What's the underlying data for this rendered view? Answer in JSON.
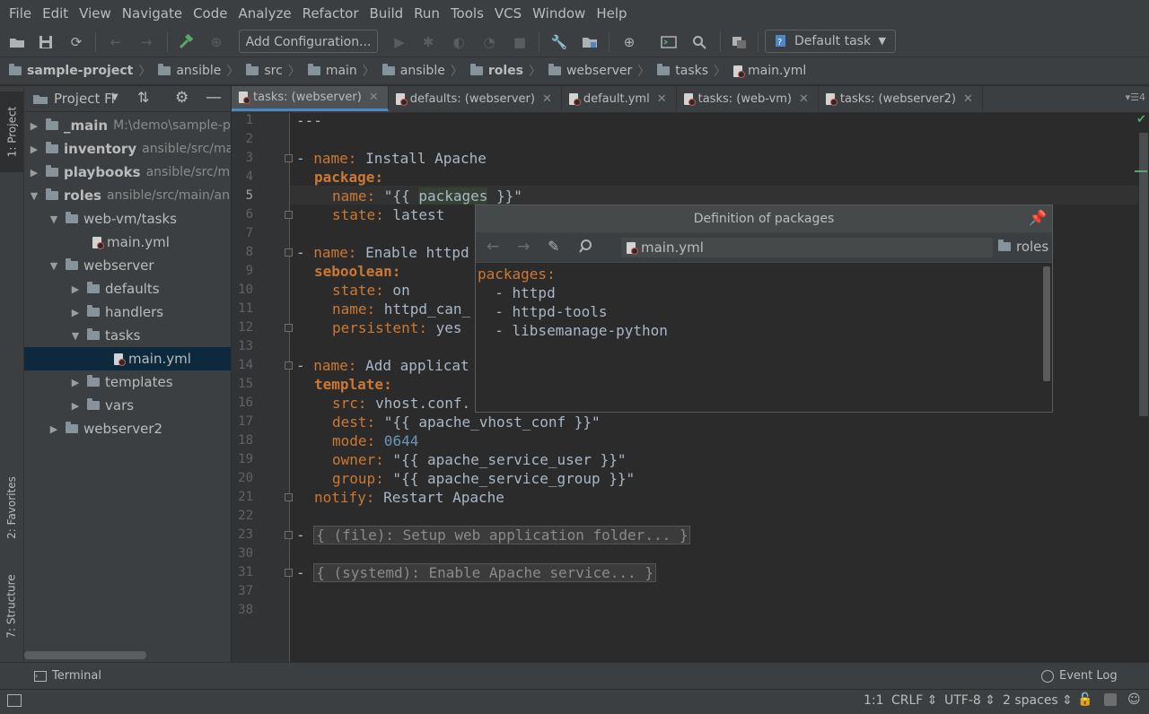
{
  "menu": [
    "File",
    "Edit",
    "View",
    "Navigate",
    "Code",
    "Analyze",
    "Refactor",
    "Build",
    "Run",
    "Tools",
    "VCS",
    "Window",
    "Help"
  ],
  "toolbar": {
    "add_config_label": "Add Configuration...",
    "task_label": "Default task"
  },
  "breadcrumb": [
    "sample-project",
    "ansible",
    "src",
    "main",
    "ansible",
    "roles",
    "webserver",
    "tasks",
    "main.yml"
  ],
  "left_strip": {
    "project": "1: Project",
    "favorites": "2: Favorites",
    "structure": "7: Structure"
  },
  "project_panel": {
    "title": "Project Fi",
    "tree": [
      {
        "label": "_main",
        "sub": "M:\\demo\\sample-p",
        "bold": true
      },
      {
        "label": "inventory",
        "sub": "ansible/src/ma",
        "bold": true
      },
      {
        "label": "playbooks",
        "sub": "ansible/src/m",
        "bold": true
      },
      {
        "label": "roles",
        "sub": "ansible/src/main/an",
        "bold": true
      },
      {
        "label": "web-vm/tasks"
      },
      {
        "label": "main.yml"
      },
      {
        "label": "webserver"
      },
      {
        "label": "defaults"
      },
      {
        "label": "handlers"
      },
      {
        "label": "tasks"
      },
      {
        "label": "main.yml"
      },
      {
        "label": "templates"
      },
      {
        "label": "vars"
      },
      {
        "label": "webserver2"
      }
    ]
  },
  "tabs": [
    "tasks: (webserver)",
    "defaults: (webserver)",
    "default.yml",
    "tasks: (web-vm)",
    "tasks: (webserver2)"
  ],
  "tabs_extra": "4",
  "editor": {
    "line_numbers": [
      "1",
      "2",
      "3",
      "4",
      "5",
      "6",
      "7",
      "8",
      "9",
      "10",
      "11",
      "12",
      "13",
      "14",
      "15",
      "16",
      "17",
      "18",
      "19",
      "20",
      "21",
      "22",
      "23",
      "30",
      "31",
      "37",
      "38"
    ],
    "lines": {
      "l1": "---",
      "l3_dash": "- ",
      "l3_key": "name:",
      "l3_val": " Install Apache",
      "l4_key": "package:",
      "l5_key": "name:",
      "l5_q1": " \"{{ ",
      "l5_var": "packages",
      "l5_q2": " }}\"",
      "l6_key": "state:",
      "l6_val": " latest",
      "l8_dash": "- ",
      "l8_key": "name:",
      "l8_val": " Enable httpd",
      "l9_key": "seboolean:",
      "l10_key": "state:",
      "l10_val": " on",
      "l11_key": "name:",
      "l11_val": " httpd_can_",
      "l12_key": "persistent:",
      "l12_val": " yes",
      "l14_dash": "- ",
      "l14_key": "name:",
      "l14_val": " Add applicat",
      "l15_key": "template:",
      "l16_key": "src:",
      "l16_val": " vhost.conf.",
      "l17_key": "dest:",
      "l17_val": " \"{{ apache_vhost_conf }}\"",
      "l18_key": "mode:",
      "l18_val": " 0644",
      "l19_key": "owner:",
      "l19_val": " \"{{ apache_service_user }}\"",
      "l20_key": "group:",
      "l20_val": " \"{{ apache_service_group }}\"",
      "l21_key": "notify:",
      "l21_val": " Restart Apache",
      "l23_dash": "- ",
      "l23_fold": "{ (file): Setup web application folder... }",
      "l31_dash": "- ",
      "l31_fold": "{ (systemd): Enable Apache service... }"
    }
  },
  "popup": {
    "title": "Definition of packages",
    "file": "main.yml",
    "location": "roles",
    "lines": [
      "packages:",
      "  - httpd",
      "  - httpd-tools",
      "  - libsemanage-python"
    ]
  },
  "bottom": {
    "terminal": "Terminal",
    "event_log": "Event Log"
  },
  "status": {
    "position": "1:1",
    "line_sep": "CRLF",
    "encoding": "UTF-8",
    "indent": "2 spaces"
  }
}
